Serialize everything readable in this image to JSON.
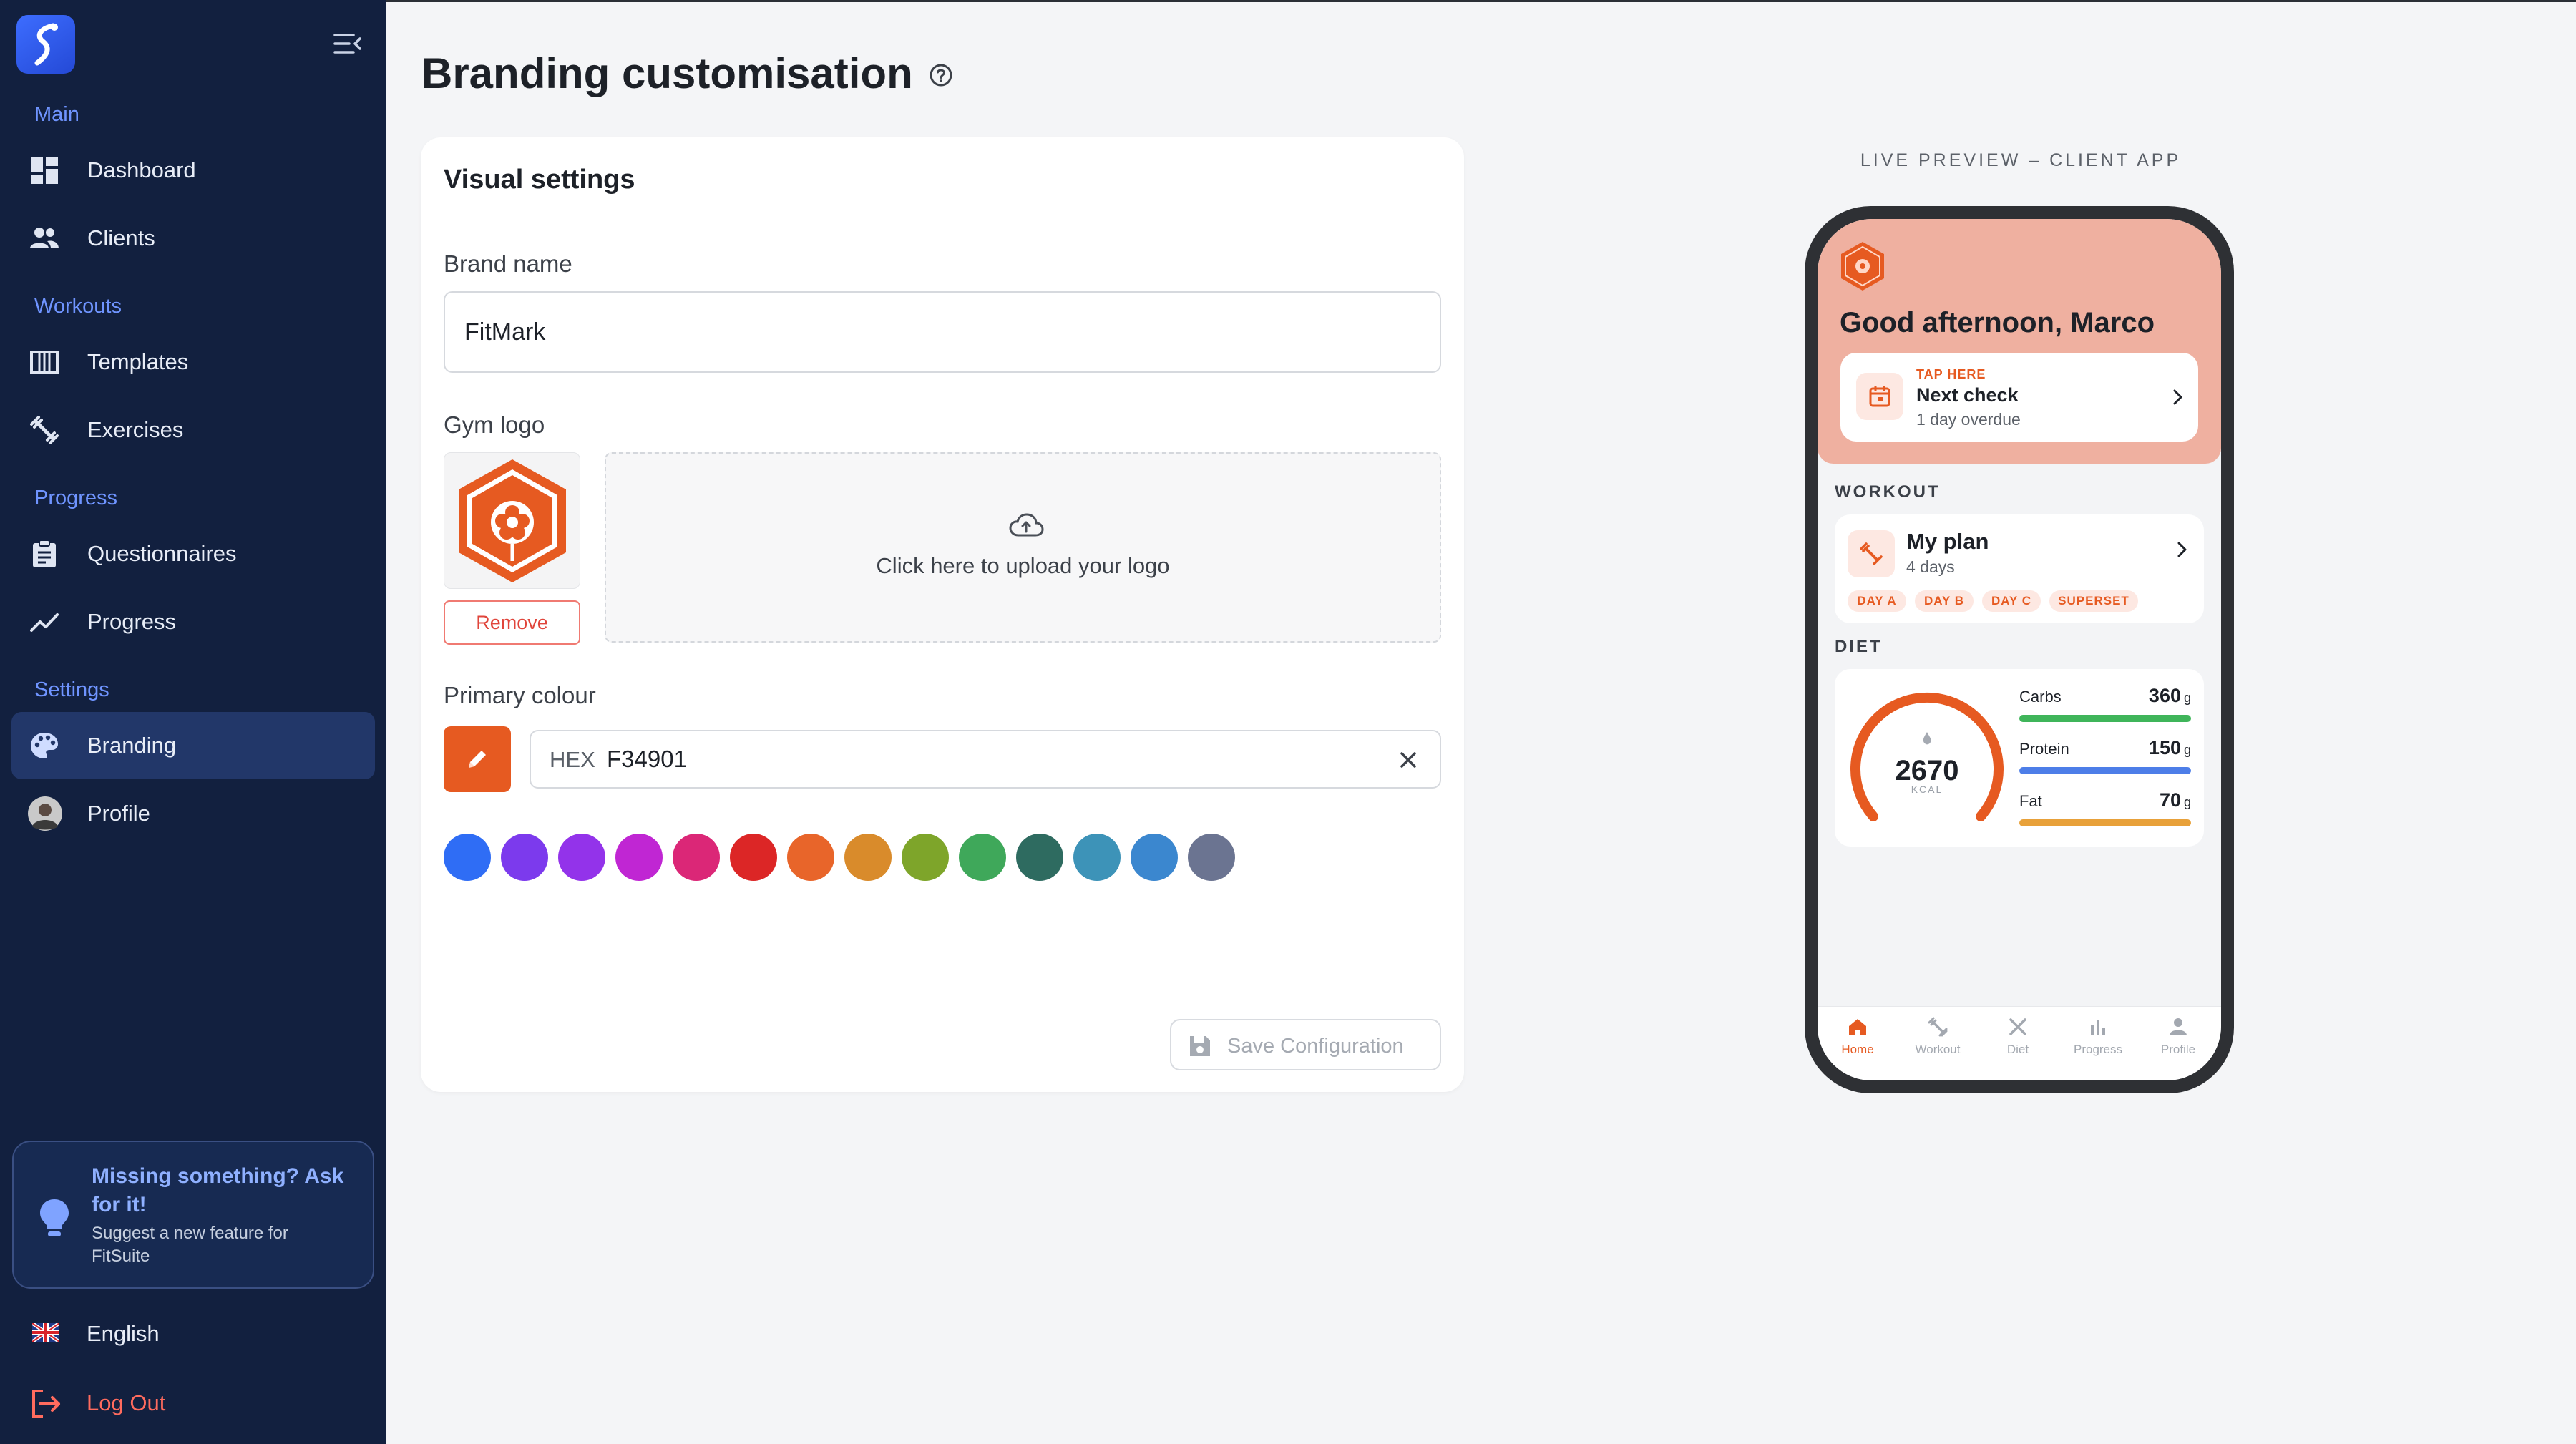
{
  "sidebar": {
    "sections": [
      {
        "label": "Main",
        "items": [
          {
            "label": "Dashboard"
          },
          {
            "label": "Clients"
          }
        ]
      },
      {
        "label": "Workouts",
        "items": [
          {
            "label": "Templates"
          },
          {
            "label": "Exercises"
          }
        ]
      },
      {
        "label": "Progress",
        "items": [
          {
            "label": "Questionnaires"
          },
          {
            "label": "Progress"
          }
        ]
      },
      {
        "label": "Settings",
        "items": [
          {
            "label": "Branding",
            "active": true
          },
          {
            "label": "Profile"
          }
        ]
      }
    ],
    "help_card": {
      "title": "Missing something? Ask for it!",
      "subtitle": "Suggest a new feature for FitSuite"
    },
    "language": "English",
    "logout": "Log Out"
  },
  "page": {
    "title": "Branding customisation"
  },
  "settings_card": {
    "title": "Visual settings",
    "brand_name_label": "Brand name",
    "brand_name_value": "FitMark",
    "logo_label": "Gym logo",
    "remove_label": "Remove",
    "upload_text": "Click here to upload your logo",
    "primary_colour_label": "Primary colour",
    "hex_prefix": "HEX",
    "hex_value": "F34901",
    "preset_colors": [
      "#2f6df5",
      "#7c3aed",
      "#9333ea",
      "#c026d3",
      "#db2777",
      "#dc2626",
      "#e8652a",
      "#d98b2b",
      "#7ea52a",
      "#3fa85a",
      "#2e6b60",
      "#3d93b8",
      "#3b87cf",
      "#6b7491"
    ],
    "selected_color": "#e65a21",
    "save_label": "Save Configuration"
  },
  "preview": {
    "label": "LIVE PREVIEW – CLIENT APP",
    "greeting": "Good afternoon, Marco",
    "check": {
      "tag": "TAP HERE",
      "title": "Next check",
      "subtitle": "1 day overdue"
    },
    "workout_section": "WORKOUT",
    "plan": {
      "name": "My plan",
      "days": "4 days",
      "chips": [
        "DAY A",
        "DAY B",
        "DAY C",
        "SUPERSET"
      ]
    },
    "diet_section": "DIET",
    "kcal_value": "2670",
    "kcal_unit": "KCAL",
    "macros": [
      {
        "name": "Carbs",
        "value": "360",
        "unit": "g",
        "color": "#3fb55a"
      },
      {
        "name": "Protein",
        "value": "150",
        "unit": "g",
        "color": "#4d7ee8"
      },
      {
        "name": "Fat",
        "value": "70",
        "unit": "g",
        "color": "#e8a13a"
      }
    ],
    "tabs": [
      {
        "label": "Home",
        "active": true
      },
      {
        "label": "Workout"
      },
      {
        "label": "Diet"
      },
      {
        "label": "Progress"
      },
      {
        "label": "Profile"
      }
    ],
    "accent": "#e65a21"
  }
}
